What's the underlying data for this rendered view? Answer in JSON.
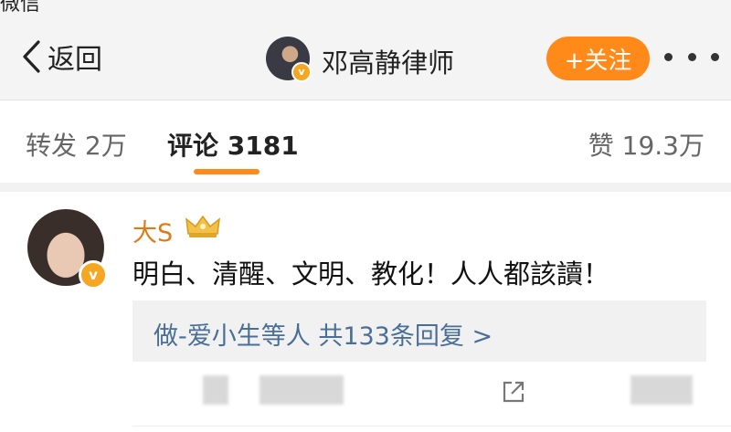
{
  "status_bar": {
    "carrier": "微信"
  },
  "nav": {
    "back_label": "返回",
    "title": "邓高静律师",
    "follow_label": "+关注"
  },
  "tabs": {
    "repost": "转发 2万",
    "comments": "评论 3181",
    "likes": "赞 19.3万"
  },
  "comment": {
    "username": "大S",
    "text": "明白、清醒、文明、教化！人人都該讀！",
    "replies": "做-爱小生等人 共133条回复 >"
  },
  "colors": {
    "accent": "#ff8a1a",
    "username": "#e07a14",
    "reply_link": "#4a6f96",
    "verified": "#f5a623"
  },
  "icons": [
    "chevron-left-icon",
    "verified-icon",
    "more-icon",
    "crown-badge-icon",
    "share-icon"
  ]
}
